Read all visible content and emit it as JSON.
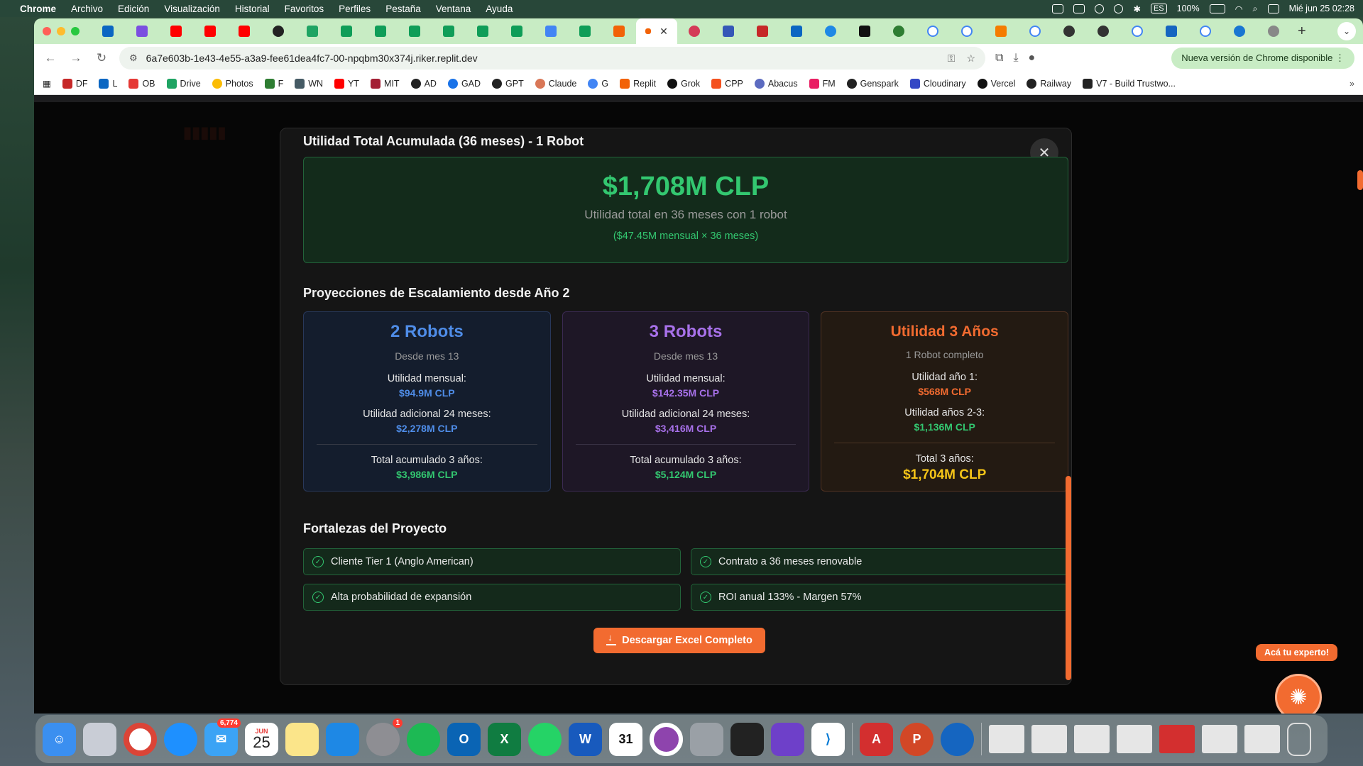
{
  "menubar": {
    "app": "Chrome",
    "items": [
      "Archivo",
      "Edición",
      "Visualización",
      "Historial",
      "Favoritos",
      "Perfiles",
      "Pestaña",
      "Ventana",
      "Ayuda"
    ],
    "battery": "100%",
    "input_lang": "ES",
    "datetime": "Mié jun 25  02:28"
  },
  "browser": {
    "url": "6a7e603b-1e43-4e55-a3a9-fee61dea4fc7-00-npqbm30x374j.riker.replit.dev",
    "update_label": "Nueva versión de Chrome disponible",
    "bookmarks": [
      "DF",
      "L",
      "OB",
      "Drive",
      "Photos",
      "F",
      "WN",
      "YT",
      "MIT",
      "AD",
      "GAD",
      "GPT",
      "Claude",
      "G",
      "Replit",
      "Grok",
      "CPP",
      "Abacus",
      "FM",
      "Genspark",
      "Cloudinary",
      "Vercel",
      "Railway",
      "V7 - Build Trustwo..."
    ]
  },
  "modal": {
    "title": "Utilidad Total Acumulada (36 meses) - 1 Robot",
    "total_value": "$1,708M CLP",
    "total_sub": "Utilidad total en 36 meses con 1 robot",
    "total_note": "($47.45M mensual × 36 meses)",
    "projections_title": "Proyecciones de Escalamiento desde Año 2",
    "cards": [
      {
        "title": "2 Robots",
        "sub": "Desde mes 13",
        "l1": "Utilidad mensual:",
        "v1": "$94.9M CLP",
        "l2": "Utilidad adicional 24 meses:",
        "v2": "$2,278M CLP",
        "l3": "Total acumulado 3 años:",
        "v3": "$3,986M CLP"
      },
      {
        "title": "3 Robots",
        "sub": "Desde mes 13",
        "l1": "Utilidad mensual:",
        "v1": "$142.35M CLP",
        "l2": "Utilidad adicional 24 meses:",
        "v2": "$3,416M CLP",
        "l3": "Total acumulado 3 años:",
        "v3": "$5,124M CLP"
      },
      {
        "title": "Utilidad 3 Años",
        "sub": "1 Robot completo",
        "l1": "Utilidad año 1:",
        "v1": "$568M CLP",
        "l2": "Utilidad años 2-3:",
        "v2": "$1,136M CLP",
        "l3": "Total 3 años:",
        "v3": "$1,704M CLP"
      }
    ],
    "strengths_title": "Fortalezas del Proyecto",
    "strengths": [
      "Cliente Tier 1 (Anglo American)",
      "Contrato a 36 meses renovable",
      "Alta probabilidad de expansión",
      "ROI anual 133% - Margen 57%"
    ],
    "download_label": "Descargar Excel Completo",
    "close_icon": "✕"
  },
  "expert": {
    "tag": "Acá tu experto!"
  },
  "dock": {
    "mail_badge": "6,774",
    "calendar_month": "JUN",
    "calendar_day": "25",
    "settings_badge": "1",
    "cal31": "31"
  },
  "colors": {
    "accent": "#f26b30",
    "green": "#33c770",
    "blue": "#4f8de8",
    "purple": "#a871ea",
    "yellow": "#f5c518"
  }
}
